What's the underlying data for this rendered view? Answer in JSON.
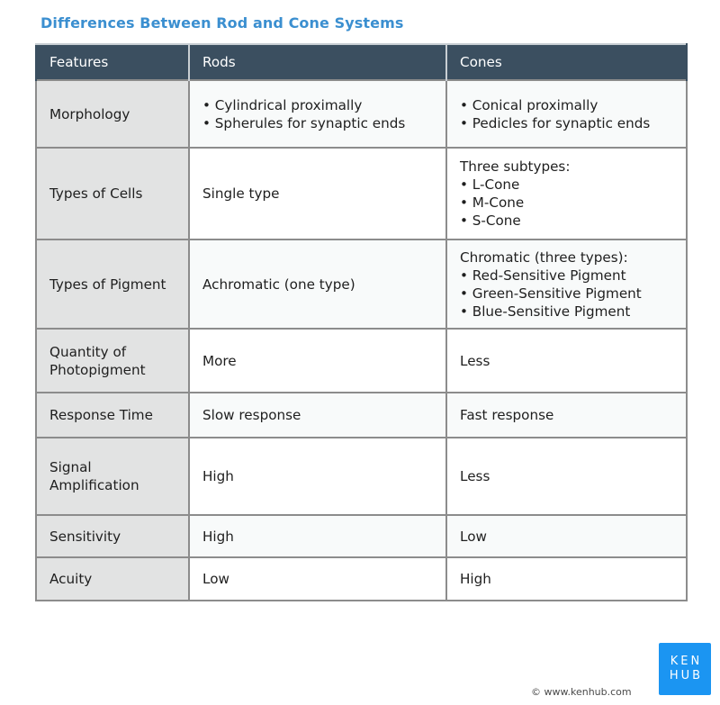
{
  "title": "Differences Between Rod and Cone Systems",
  "colors": {
    "title": "#3b8fd0",
    "header_bg": "#3b4f60",
    "feature_col_bg": "#e2e3e3",
    "logo_bg": "#1b95f2"
  },
  "table": {
    "headers": [
      "Features",
      "Rods",
      "Cones"
    ],
    "rows": [
      {
        "feature": [
          "Morphology"
        ],
        "rods": [
          "• Cylindrical proximally",
          "• Spherules for synaptic ends"
        ],
        "cones": [
          "• Conical proximally",
          "• Pedicles for synaptic ends"
        ]
      },
      {
        "feature": [
          "Types of Cells"
        ],
        "rods": [
          "Single type"
        ],
        "cones": [
          "Three subtypes:",
          "• L-Cone",
          "• M-Cone",
          "• S-Cone"
        ]
      },
      {
        "feature": [
          "Types of Pigment"
        ],
        "rods": [
          "Achromatic (one type)"
        ],
        "cones": [
          "Chromatic (three types):",
          "• Red-Sensitive Pigment",
          "• Green-Sensitive Pigment",
          "• Blue-Sensitive Pigment"
        ]
      },
      {
        "feature": [
          "Quantity of",
          "Photopigment"
        ],
        "rods": [
          "More"
        ],
        "cones": [
          "Less"
        ]
      },
      {
        "feature": [
          "Response Time"
        ],
        "rods": [
          "Slow response"
        ],
        "cones": [
          "Fast response"
        ]
      },
      {
        "feature": [
          "Signal",
          "Amplification"
        ],
        "rods": [
          "High"
        ],
        "cones": [
          "Less"
        ]
      },
      {
        "feature": [
          "Sensitivity"
        ],
        "rods": [
          "High"
        ],
        "cones": [
          "Low"
        ]
      },
      {
        "feature": [
          "Acuity"
        ],
        "rods": [
          "Low"
        ],
        "cones": [
          "High"
        ]
      }
    ]
  },
  "footer": {
    "copyright": "© www.kenhub.com"
  },
  "logo": {
    "line1": "KEN",
    "line2": "HUB"
  }
}
